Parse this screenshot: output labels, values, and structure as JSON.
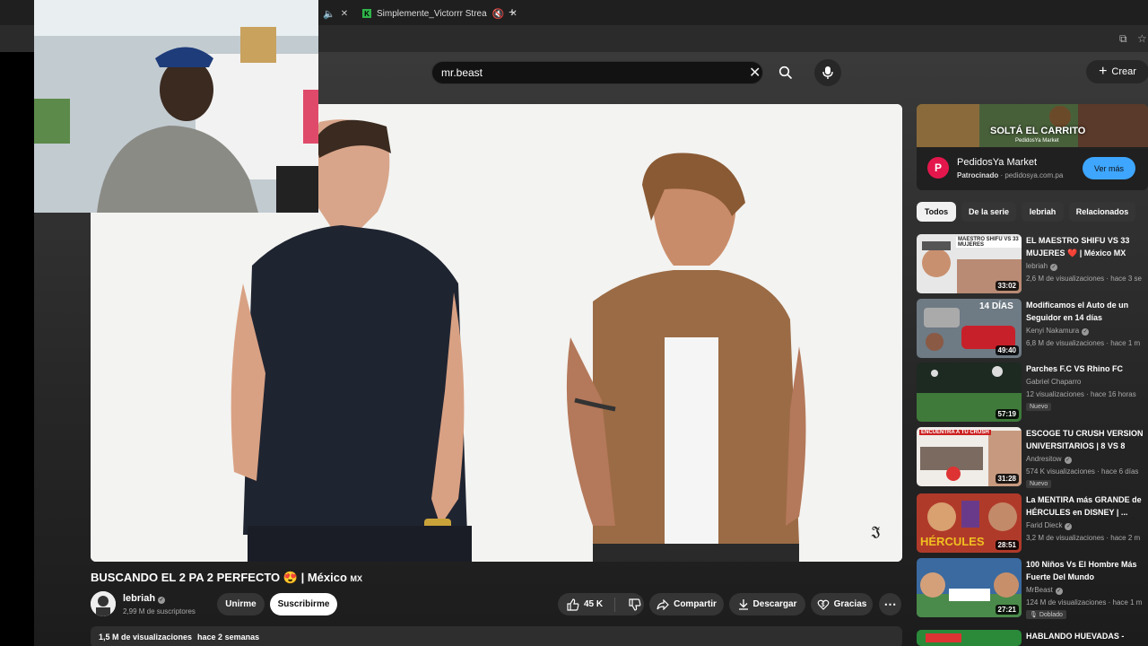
{
  "browser": {
    "tabs": [
      {
        "label": "Simplemente_Victorrr Strea"
      }
    ]
  },
  "search": {
    "value": "mr.beast"
  },
  "header": {
    "create_label": "Crear"
  },
  "video": {
    "title": "BUSCANDO EL 2 PA 2 PERFECTO 😍 | México",
    "title_suffix": "MX",
    "channel": "lebriah",
    "subscribers": "2,99 M de suscriptores",
    "join_label": "Unirme",
    "subscribe_label": "Suscribirme",
    "likes": "45 K",
    "share_label": "Compartir",
    "download_label": "Descargar",
    "thanks_label": "Gracias",
    "views": "1,5 M de visualizaciones",
    "age": "hace 2 semanas"
  },
  "ad": {
    "banner_text": "SOLTÁ EL CARRITO",
    "banner_sub": "PedidosYa Market",
    "name": "PedidosYa Market",
    "sponsored": "Patrocinado",
    "domain": "· pedidosya.com.pa",
    "cta": "Ver más"
  },
  "chips": [
    "Todos",
    "De la serie",
    "lebriah",
    "Relacionados"
  ],
  "recommendations": [
    {
      "title1": "EL MAESTRO SHIFU VS 33",
      "title2": "MUJERES ❤️ | México MX",
      "channel": "lebriah",
      "meta": "2,6 M de visualizaciones · hace 3 se",
      "duration": "33:02",
      "thumb_text": "MAESTRO SHIFU VS 33 MUJERES"
    },
    {
      "title1": "Modificamos el Auto de un",
      "title2": "Seguidor en 14 días",
      "channel": "Kenyi Nakamura",
      "meta": "6,8 M de visualizaciones · hace 1 m",
      "duration": "49:40",
      "thumb_text": "14 DÍAS"
    },
    {
      "title1": "Parches F.C VS Rhino FC",
      "title2": "",
      "channel": "Gabriel Chaparro",
      "meta": "12 visualizaciones · hace 16 horas",
      "duration": "57:19",
      "badge": "Nuevo"
    },
    {
      "title1": "ESCOGE TU CRUSH VERSION",
      "title2": "UNIVERSITARIOS | 8 VS 8",
      "channel": "Andresitow",
      "meta": "574 K visualizaciones · hace 6 días",
      "duration": "31:28",
      "badge": "Nuevo",
      "thumb_text": "ENCUENTRA A TU CRUSH"
    },
    {
      "title1": "La MENTIRA más GRANDE de",
      "title2": "HÉRCULES en DISNEY | ...",
      "channel": "Farid Dieck",
      "meta": "3,2 M de visualizaciones · hace 2 m",
      "duration": "28:51",
      "thumb_text": "HÉRCULES"
    },
    {
      "title1": "100 Niños Vs El Hombre Más",
      "title2": "Fuerte Del Mundo",
      "channel": "MrBeast",
      "meta": "124 M de visualizaciones · hace 1 m",
      "duration": "27:21",
      "badge": "Doblado"
    },
    {
      "title1": "HABLANDO HUEVADAS -",
      "title2": "",
      "channel": "",
      "meta": "",
      "duration": ""
    }
  ]
}
